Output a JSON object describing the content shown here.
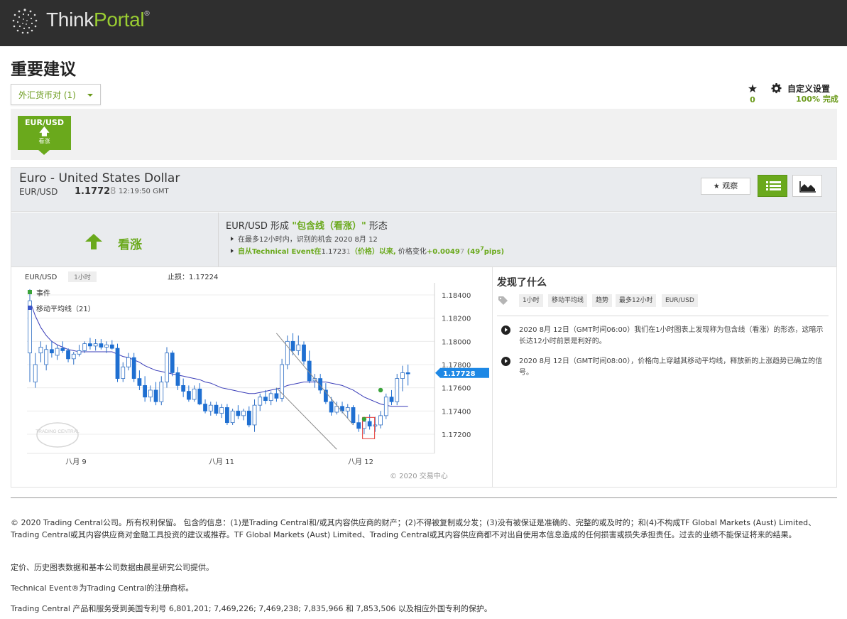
{
  "brand": {
    "part1": "Think",
    "part2": "Portal",
    "mark": "®"
  },
  "page_title": "重要建议",
  "filter": {
    "label": "外汇货币对 (1)"
  },
  "favorites": {
    "count": "0"
  },
  "settings": {
    "label": "自定义设置",
    "progress": "100% 完成"
  },
  "pair_card": {
    "symbol": "EUR/USD",
    "direction": "看涨"
  },
  "instrument": {
    "name": "Euro - United States Dollar",
    "symbol": "EUR/USD",
    "price_main": "1.1772",
    "price_last": "8",
    "time": "12:19:50 GMT"
  },
  "buttons": {
    "watch": "观察"
  },
  "signal": {
    "direction": "看涨",
    "title_prefix": "EUR/USD 形成 ",
    "title_pattern": "\"包含线（看涨）\"",
    "title_suffix": " 形态",
    "line1": "在最多12小时内，识别的机会 2020 8月 12",
    "line2_prefix": "自从Technical Event在",
    "line2_price": "1.1723",
    "line2_price_last": "1",
    "line2_label": "（价格）以来,",
    "line2_change_label": " 价格变化",
    "line2_change": "+0.0049",
    "line2_change_last": "7",
    "line2_pips_open": " (49",
    "line2_pips_sup": "7",
    "line2_pips_close": "pips)"
  },
  "found": {
    "title": "发现了什么",
    "tags": [
      "1小时",
      "移动平均线",
      "趋势",
      "最多12小时",
      "EUR/USD"
    ],
    "events": [
      "2020 8月 12日（GMT时间06:00）我们在1小时图表上发现称为包含线（看涨）的形态，这暗示长达12小时前景是利好的。",
      "2020 8月 12日（GMT时间08:00），价格向上穿越其移动平均线，释放新的上涨趋势已确立的信号。"
    ]
  },
  "chart_data": {
    "type": "candlestick",
    "symbol": "EUR/USD",
    "timeframe": "1小时",
    "stop_loss_label": "止损：",
    "stop_loss": "1.17224",
    "legend": [
      "事件",
      "移动平均线（21）"
    ],
    "current_price_label": "1.17728",
    "y_ticks": [
      "1.18400",
      "1.18200",
      "1.18000",
      "1.17800",
      "1.17600",
      "1.17400",
      "1.17200"
    ],
    "x_ticks": [
      "八月 9",
      "八月 11",
      "八月 12"
    ],
    "watermark": "TRADING CENTRAL",
    "credit": "© 2020 交易中心",
    "ylim": [
      1.1705,
      1.185
    ],
    "current_price": 1.17728,
    "candles": [
      [
        1.179,
        1.1845,
        1.1765,
        1.1835
      ],
      [
        1.1765,
        1.179,
        1.176,
        1.178
      ],
      [
        1.179,
        1.18,
        1.1782,
        1.1795
      ],
      [
        1.178,
        1.1797,
        1.1775,
        1.1793
      ],
      [
        1.1793,
        1.18,
        1.1786,
        1.179
      ],
      [
        1.1788,
        1.1797,
        1.1784,
        1.1794
      ],
      [
        1.1794,
        1.18,
        1.179,
        1.1792
      ],
      [
        1.1792,
        1.1794,
        1.1782,
        1.1785
      ],
      [
        1.1785,
        1.1791,
        1.178,
        1.1789
      ],
      [
        1.1789,
        1.1797,
        1.1787,
        1.1792
      ],
      [
        1.1792,
        1.18,
        1.179,
        1.1798
      ],
      [
        1.1798,
        1.1803,
        1.1793,
        1.1796
      ],
      [
        1.1796,
        1.1802,
        1.1792,
        1.1798
      ],
      [
        1.1798,
        1.1802,
        1.1793,
        1.1795
      ],
      [
        1.1795,
        1.18,
        1.179,
        1.1797
      ],
      [
        1.1797,
        1.1801,
        1.1793,
        1.1794
      ],
      [
        1.1794,
        1.1798,
        1.1765,
        1.1768
      ],
      [
        1.1768,
        1.1782,
        1.1765,
        1.1778
      ],
      [
        1.1778,
        1.179,
        1.1775,
        1.1786
      ],
      [
        1.1786,
        1.179,
        1.1765,
        1.1768
      ],
      [
        1.1768,
        1.1775,
        1.1758,
        1.1762
      ],
      [
        1.1762,
        1.177,
        1.1748,
        1.1752
      ],
      [
        1.1752,
        1.1762,
        1.1748,
        1.1758
      ],
      [
        1.1758,
        1.1765,
        1.1745,
        1.1748
      ],
      [
        1.1748,
        1.177,
        1.1745,
        1.1765
      ],
      [
        1.1765,
        1.1795,
        1.176,
        1.179
      ],
      [
        1.179,
        1.1792,
        1.177,
        1.1773
      ],
      [
        1.1773,
        1.1778,
        1.1758,
        1.1762
      ],
      [
        1.1762,
        1.1768,
        1.1752,
        1.1757
      ],
      [
        1.1757,
        1.1762,
        1.1748,
        1.175
      ],
      [
        1.175,
        1.1762,
        1.1748,
        1.1759
      ],
      [
        1.1759,
        1.1764,
        1.1745,
        1.1746
      ],
      [
        1.1746,
        1.175,
        1.1738,
        1.174
      ],
      [
        1.174,
        1.1748,
        1.1736,
        1.1745
      ],
      [
        1.1745,
        1.1748,
        1.1736,
        1.1738
      ],
      [
        1.1738,
        1.1746,
        1.1734,
        1.1743
      ],
      [
        1.1743,
        1.1746,
        1.1728,
        1.173
      ],
      [
        1.173,
        1.1742,
        1.1728,
        1.174
      ],
      [
        1.174,
        1.1745,
        1.1733,
        1.1736
      ],
      [
        1.1736,
        1.1742,
        1.1732,
        1.174
      ],
      [
        1.174,
        1.1744,
        1.1726,
        1.1728
      ],
      [
        1.1728,
        1.175,
        1.1722,
        1.1745
      ],
      [
        1.1745,
        1.1755,
        1.174,
        1.1752
      ],
      [
        1.1752,
        1.1758,
        1.1746,
        1.1749
      ],
      [
        1.1749,
        1.1757,
        1.1745,
        1.1755
      ],
      [
        1.1755,
        1.176,
        1.1748,
        1.1751
      ],
      [
        1.1751,
        1.1785,
        1.1748,
        1.178
      ],
      [
        1.178,
        1.1805,
        1.1776,
        1.18
      ],
      [
        1.18,
        1.1807,
        1.1788,
        1.1792
      ],
      [
        1.1792,
        1.1805,
        1.1788,
        1.1797
      ],
      [
        1.1797,
        1.18,
        1.178,
        1.1783
      ],
      [
        1.1783,
        1.1792,
        1.1764,
        1.1766
      ],
      [
        1.1766,
        1.1772,
        1.176,
        1.1768
      ],
      [
        1.1768,
        1.1772,
        1.1755,
        1.1758
      ],
      [
        1.1758,
        1.1764,
        1.1746,
        1.1748
      ],
      [
        1.1748,
        1.1752,
        1.1736,
        1.1739
      ],
      [
        1.1739,
        1.1748,
        1.1737,
        1.1744
      ],
      [
        1.1744,
        1.1748,
        1.1738,
        1.174
      ],
      [
        1.174,
        1.1746,
        1.1734,
        1.1743
      ],
      [
        1.1743,
        1.1745,
        1.1728,
        1.173
      ],
      [
        1.173,
        1.1737,
        1.1722,
        1.1725
      ],
      [
        1.1725,
        1.1733,
        1.172,
        1.1731
      ],
      [
        1.1731,
        1.1737,
        1.1724,
        1.1727
      ],
      [
        1.1727,
        1.1735,
        1.1722,
        1.1728
      ],
      [
        1.1728,
        1.174,
        1.1725,
        1.1736
      ],
      [
        1.1736,
        1.1755,
        1.1733,
        1.1752
      ],
      [
        1.1752,
        1.1758,
        1.1745,
        1.1748
      ],
      [
        1.1748,
        1.1772,
        1.1745,
        1.1768
      ],
      [
        1.1768,
        1.1779,
        1.1757,
        1.1773
      ],
      [
        1.1773,
        1.178,
        1.1762,
        1.1772
      ]
    ],
    "ma": [
      1.1835,
      1.1822,
      1.1812,
      1.1805,
      1.18,
      1.1797,
      1.1795,
      1.1793,
      1.1792,
      1.1791,
      1.1791,
      1.1791,
      1.1791,
      1.1791,
      1.1791,
      1.1791,
      1.1789,
      1.1787,
      1.1786,
      1.1784,
      1.1782,
      1.1779,
      1.1777,
      1.1775,
      1.1774,
      1.1773,
      1.1772,
      1.1771,
      1.177,
      1.1769,
      1.1768,
      1.1767,
      1.1765,
      1.1764,
      1.1762,
      1.176,
      1.1759,
      1.1758,
      1.1757,
      1.1756,
      1.1755,
      1.1755,
      1.1756,
      1.1757,
      1.1758,
      1.1759,
      1.176,
      1.1762,
      1.1763,
      1.1764,
      1.1765,
      1.1765,
      1.1765,
      1.1765,
      1.1765,
      1.1764,
      1.1763,
      1.1762,
      1.176,
      1.1758,
      1.1755,
      1.1752,
      1.175,
      1.1748,
      1.1746,
      1.1745,
      1.1744,
      1.1744,
      1.1744,
      1.1744
    ],
    "events": [
      {
        "candle": 61,
        "price": 1.1733
      },
      {
        "candle": 64,
        "price": 1.1758
      }
    ],
    "pattern_candle": 62,
    "channel": [
      {
        "from": [
          45,
          1.1807
        ],
        "to": [
          59,
          1.1728
        ]
      },
      {
        "from": [
          45,
          1.176
        ],
        "to": [
          56,
          1.1707
        ]
      }
    ]
  },
  "footer": {
    "p1": "© 2020 Trading Central公司。所有权利保留。 包含的信息：(1)是Trading Central和/或其内容供应商的财产；(2)不得被复制或分发；(3)没有被保证是准确的、完整的或及时的；和(4)不构成TF Global Markets (Aust) Limited、Trading Central或其内容供应商对金融工具投资的建议或推荐。TF Global Markets (Aust) Limited、Trading Central或其内容供应商都不对出自使用本信息造成的任何损害或损失承担责任。过去的业绩不能保证将来的结果。",
    "p2": "定价、历史图表数据和基本公司数据由晨星研究公司提供。",
    "p3": "Technical Event®为Trading Central的注册商标。",
    "p4": "Trading Central 产品和服务受到美国专利号 6,801,201; 7,469,226; 7,469,238; 7,835,966 和 7,853,506 以及相应外国专利的保护。"
  }
}
